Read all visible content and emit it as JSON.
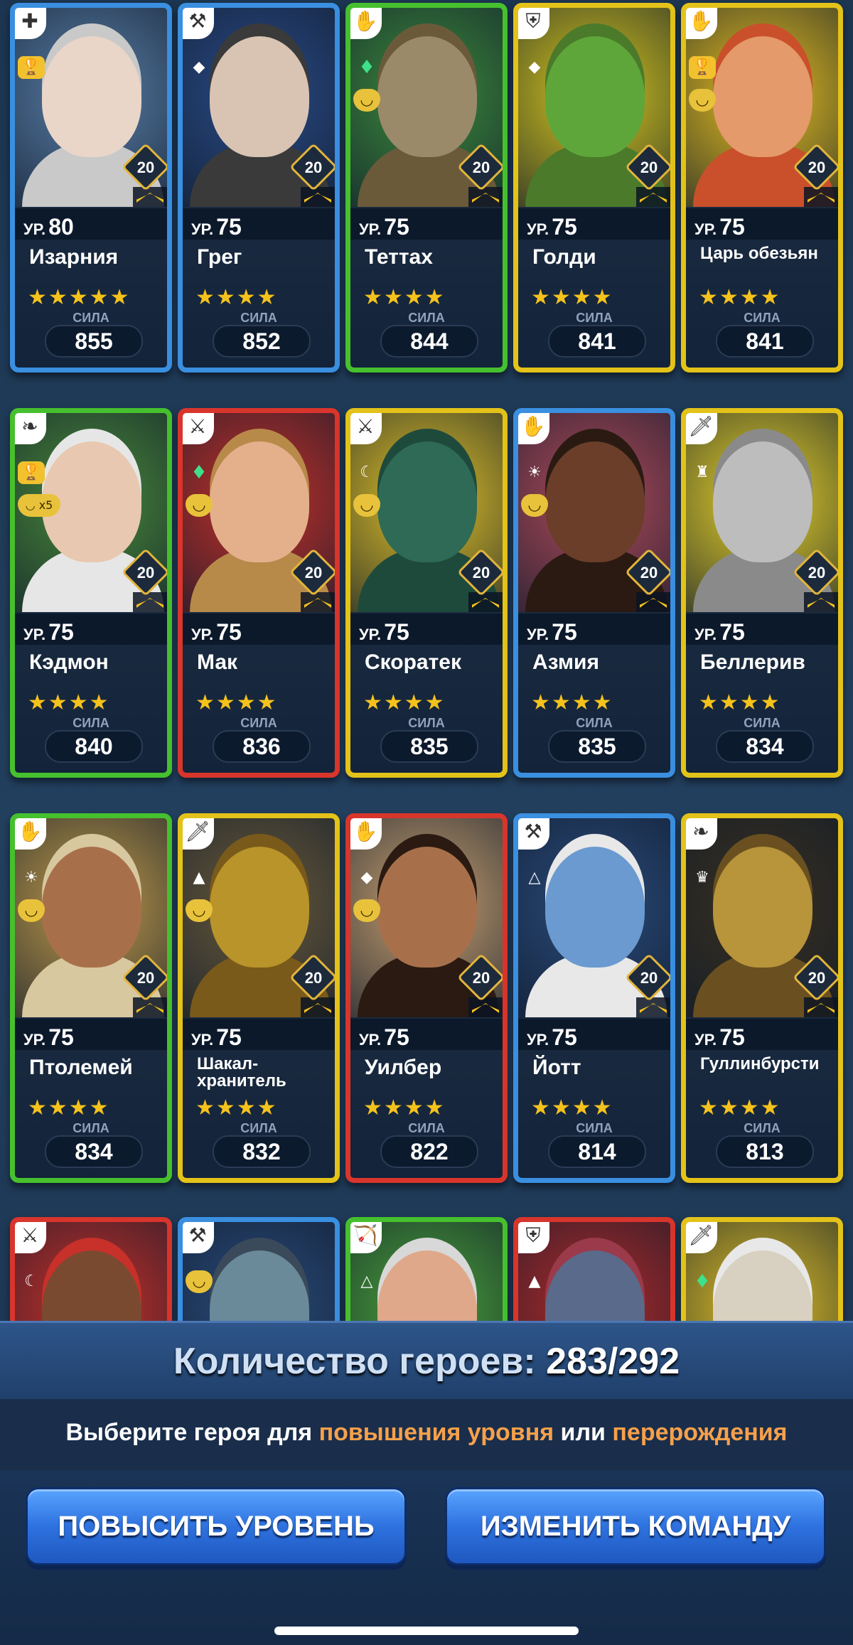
{
  "level_prefix": "УР.",
  "power_label": "СИЛА",
  "heroes": [
    {
      "name": "Изарния",
      "level": "80",
      "stars": "★★★★★",
      "power": "855",
      "badge": "20",
      "frame": "blue",
      "class_icon": "book-icon",
      "glyph": "✚",
      "side": [
        "trophy-icon"
      ],
      "tone": "#e9d6c8",
      "hair": "#c9c9c9",
      "bg": "#5a7ea8"
    },
    {
      "name": "Грег",
      "level": "75",
      "stars": "★★★★",
      "power": "852",
      "badge": "20",
      "frame": "blue",
      "class_icon": "axe-icon",
      "glyph": "⚒",
      "side": [
        "totem-icon"
      ],
      "tone": "#d9c4b4",
      "hair": "#3a3a3a",
      "bg": "#2a4a86"
    },
    {
      "name": "Теттах",
      "level": "75",
      "stars": "★★★★",
      "power": "844",
      "badge": "20",
      "frame": "green",
      "class_icon": "hand-icon",
      "glyph": "✋",
      "side": [
        "crystal-icon",
        "mask-icon"
      ],
      "tone": "#9a8a6a",
      "hair": "#6b5a3a",
      "bg": "#3d8a3c"
    },
    {
      "name": "Голди",
      "level": "75",
      "stars": "★★★★",
      "power": "841",
      "badge": "20",
      "frame": "yellow",
      "class_icon": "shield-icon",
      "glyph": "⛨",
      "side": [
        "goblin-icon"
      ],
      "tone": "#5ea63a",
      "hair": "#4a7a2a",
      "bg": "#d8c71e"
    },
    {
      "name": "Царь обезьян",
      "level": "75",
      "stars": "★★★★",
      "power": "841",
      "badge": "20",
      "frame": "yellow",
      "class_icon": "hand-icon",
      "glyph": "✋",
      "side": [
        "trophy-icon",
        "mask-icon"
      ],
      "tone": "#e49a6a",
      "hair": "#c9502a",
      "bg": "#e8c020"
    },
    {
      "name": "Кэдмон",
      "level": "75",
      "stars": "★★★★",
      "power": "840",
      "badge": "20",
      "frame": "green",
      "class_icon": "leaf-icon",
      "glyph": "❧",
      "side": [
        "trophy-icon",
        "mask-x5-icon"
      ],
      "tone": "#e8c8b0",
      "hair": "#e6e6e6",
      "bg": "#4a8a3a"
    },
    {
      "name": "Мак",
      "level": "75",
      "stars": "★★★★",
      "power": "836",
      "badge": "20",
      "frame": "red",
      "class_icon": "swords-icon",
      "glyph": "⚔",
      "side": [
        "crystal-icon",
        "mask-icon"
      ],
      "tone": "#e4b08c",
      "hair": "#b88a4a",
      "bg": "#c4302a"
    },
    {
      "name": "Скоратек",
      "level": "75",
      "stars": "★★★★",
      "power": "835",
      "badge": "20",
      "frame": "yellow",
      "class_icon": "swords-icon",
      "glyph": "⚔",
      "side": [
        "moon-icon",
        "mask-icon"
      ],
      "tone": "#2e6a56",
      "hair": "#1e4a3c",
      "bg": "#e2c228"
    },
    {
      "name": "Азмия",
      "level": "75",
      "stars": "★★★★",
      "power": "835",
      "badge": "20",
      "frame": "blue",
      "class_icon": "hand-icon",
      "glyph": "✋",
      "side": [
        "sun-icon",
        "mask-icon"
      ],
      "tone": "#6a3e28",
      "hair": "#2a1a12",
      "bg": "#b04a5a"
    },
    {
      "name": "Беллерив",
      "level": "75",
      "stars": "★★★★",
      "power": "834",
      "badge": "20",
      "frame": "yellow",
      "class_icon": "dagger-icon",
      "glyph": "🗡",
      "side": [
        "castle-icon"
      ],
      "tone": "#bdbdbd",
      "hair": "#8a8a8a",
      "bg": "#e8d22a"
    },
    {
      "name": "Птолемей",
      "level": "75",
      "stars": "★★★★",
      "power": "834",
      "badge": "20",
      "frame": "green",
      "class_icon": "hand-icon",
      "glyph": "✋",
      "side": [
        "sun-icon",
        "mask-icon"
      ],
      "tone": "#a8704a",
      "hair": "#d8c8a0",
      "bg": "#c09a4a"
    },
    {
      "name": "Шакал-хранитель",
      "level": "75",
      "stars": "★★★★",
      "power": "832",
      "badge": "20",
      "frame": "yellow",
      "class_icon": "dagger-icon",
      "glyph": "🗡",
      "side": [
        "pyramid-icon",
        "mask-icon"
      ],
      "tone": "#b8942a",
      "hair": "#7a5a1a",
      "bg": "#6a5a3a"
    },
    {
      "name": "Уилбер",
      "level": "75",
      "stars": "★★★★",
      "power": "822",
      "badge": "20",
      "frame": "red",
      "class_icon": "hand-icon",
      "glyph": "✋",
      "side": [
        "leaf-icon",
        "mask-icon"
      ],
      "tone": "#a8704a",
      "hair": "#2a1a12",
      "bg": "#c8a070"
    },
    {
      "name": "Йотт",
      "level": "75",
      "stars": "★★★★",
      "power": "814",
      "badge": "20",
      "frame": "blue",
      "class_icon": "axe-icon",
      "glyph": "⚒",
      "side": [
        "delta-icon"
      ],
      "tone": "#6a9ad0",
      "hair": "#e8e8e8",
      "bg": "#2a4a7a"
    },
    {
      "name": "Гуллинбурсти",
      "level": "75",
      "stars": "★★★★",
      "power": "813",
      "badge": "20",
      "frame": "yellow",
      "class_icon": "leaf-icon",
      "glyph": "❧",
      "side": [
        "crown-icon"
      ],
      "tone": "#b8943a",
      "hair": "#6a5020",
      "bg": "#3a3020"
    },
    {
      "name": "",
      "level": "",
      "stars": "",
      "power": "",
      "badge": "",
      "frame": "red",
      "class_icon": "swords-icon",
      "glyph": "⚔",
      "side": [
        "moon-icon"
      ],
      "tone": "#7a4a30",
      "hair": "#c8302a",
      "bg": "#c8302a"
    },
    {
      "name": "",
      "level": "",
      "stars": "",
      "power": "",
      "badge": "",
      "frame": "blue",
      "class_icon": "axe-icon",
      "glyph": "⚒",
      "side": [
        "mask-icon"
      ],
      "tone": "#6a8a9a",
      "hair": "#3a4a5a",
      "bg": "#2a4a7a"
    },
    {
      "name": "",
      "level": "",
      "stars": "",
      "power": "",
      "badge": "",
      "frame": "green",
      "class_icon": "bow-icon",
      "glyph": "🏹",
      "side": [
        "delta-icon"
      ],
      "tone": "#e0a88a",
      "hair": "#d8d8d8",
      "bg": "#4aa03a"
    },
    {
      "name": "",
      "level": "",
      "stars": "",
      "power": "",
      "badge": "",
      "frame": "red",
      "class_icon": "shield-icon",
      "glyph": "⛨",
      "side": [
        "pyramid-icon"
      ],
      "tone": "#5a6a8a",
      "hair": "#9a3a4a",
      "bg": "#b02a2a"
    },
    {
      "name": "",
      "level": "",
      "stars": "",
      "power": "",
      "badge": "",
      "frame": "yellow",
      "class_icon": "dagger-icon",
      "glyph": "🗡",
      "side": [
        "crystal-icon"
      ],
      "tone": "#d8d0c0",
      "hair": "#e8e8e8",
      "bg": "#e0c028"
    }
  ],
  "footer": {
    "count_label": "Количество героев:",
    "count_value": "283/292",
    "hint_pre": "Выберите героя для ",
    "hint_hl1": "повышения уровня",
    "hint_mid": " или ",
    "hint_hl2": "перерождения",
    "btn_level_up": "ПОВЫСИТЬ УРОВЕНЬ",
    "btn_change_team": "ИЗМЕНИТЬ КОМАНДУ"
  }
}
